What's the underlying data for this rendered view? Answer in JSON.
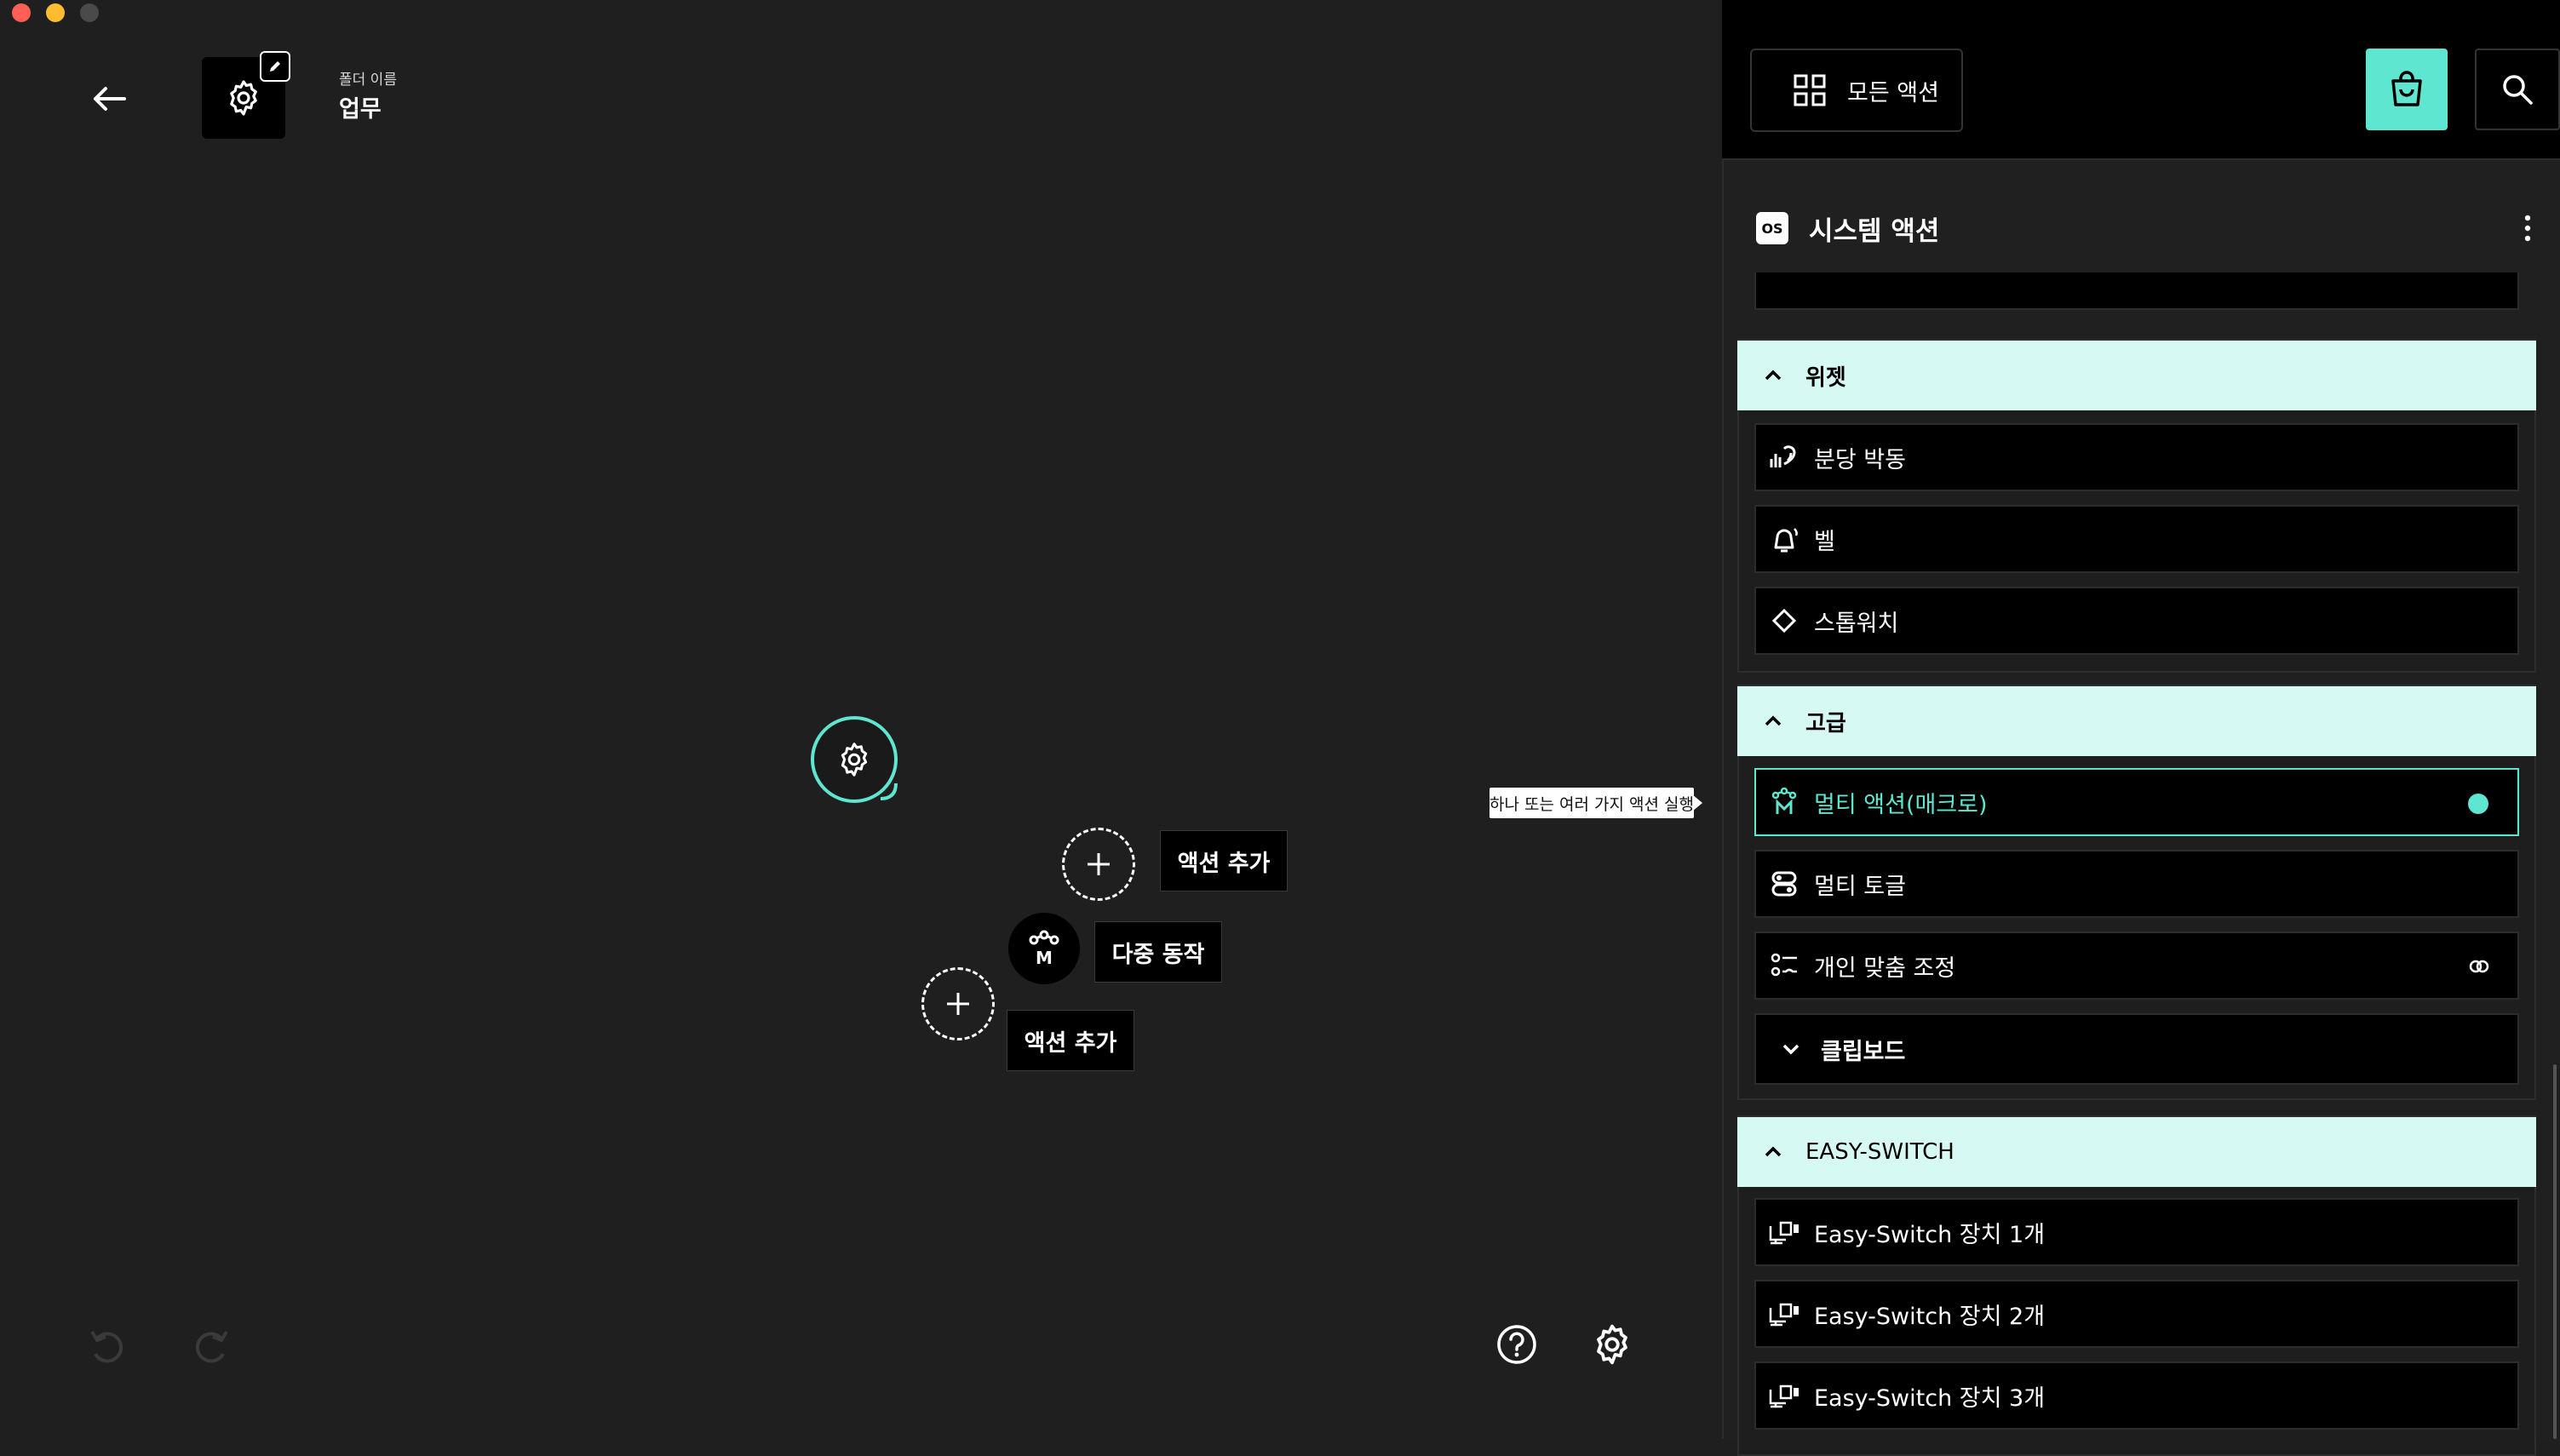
{
  "window": {
    "traffic_lights": [
      "#ff5f57",
      "#febc2e",
      "#4a4a4a"
    ]
  },
  "header": {
    "folder_caption": "폴더 이름",
    "folder_name": "업무"
  },
  "canvas": {
    "add_action_1": "액션 추가",
    "multi_action": "다중 동작",
    "add_action_2": "액션 추가",
    "macro_node_letter": "M"
  },
  "tooltip": {
    "text": "하나 또는 여러 가지 액션 실행"
  },
  "panel": {
    "all_actions_label": "모든 액션",
    "os_badge": "OS",
    "section_title": "시스템 액션",
    "groups": [
      {
        "title": "위젯",
        "items": [
          "분당 박동",
          "벨",
          "스톱워치"
        ]
      },
      {
        "title": "고급",
        "items": [
          "멀티 액션(매크로)",
          "멀티 토글",
          "개인 맞춤 조정"
        ]
      },
      {
        "title": "클립보드"
      },
      {
        "title": "EASY-SWITCH",
        "items": [
          "Easy-Switch 장치 1개",
          "Easy-Switch 장치 2개",
          "Easy-Switch 장치 3개"
        ]
      }
    ]
  },
  "colors": {
    "accent": "#5ee6d0",
    "group_header_bg": "#d6faf3",
    "canvas_bg": "#1f1f1f"
  }
}
